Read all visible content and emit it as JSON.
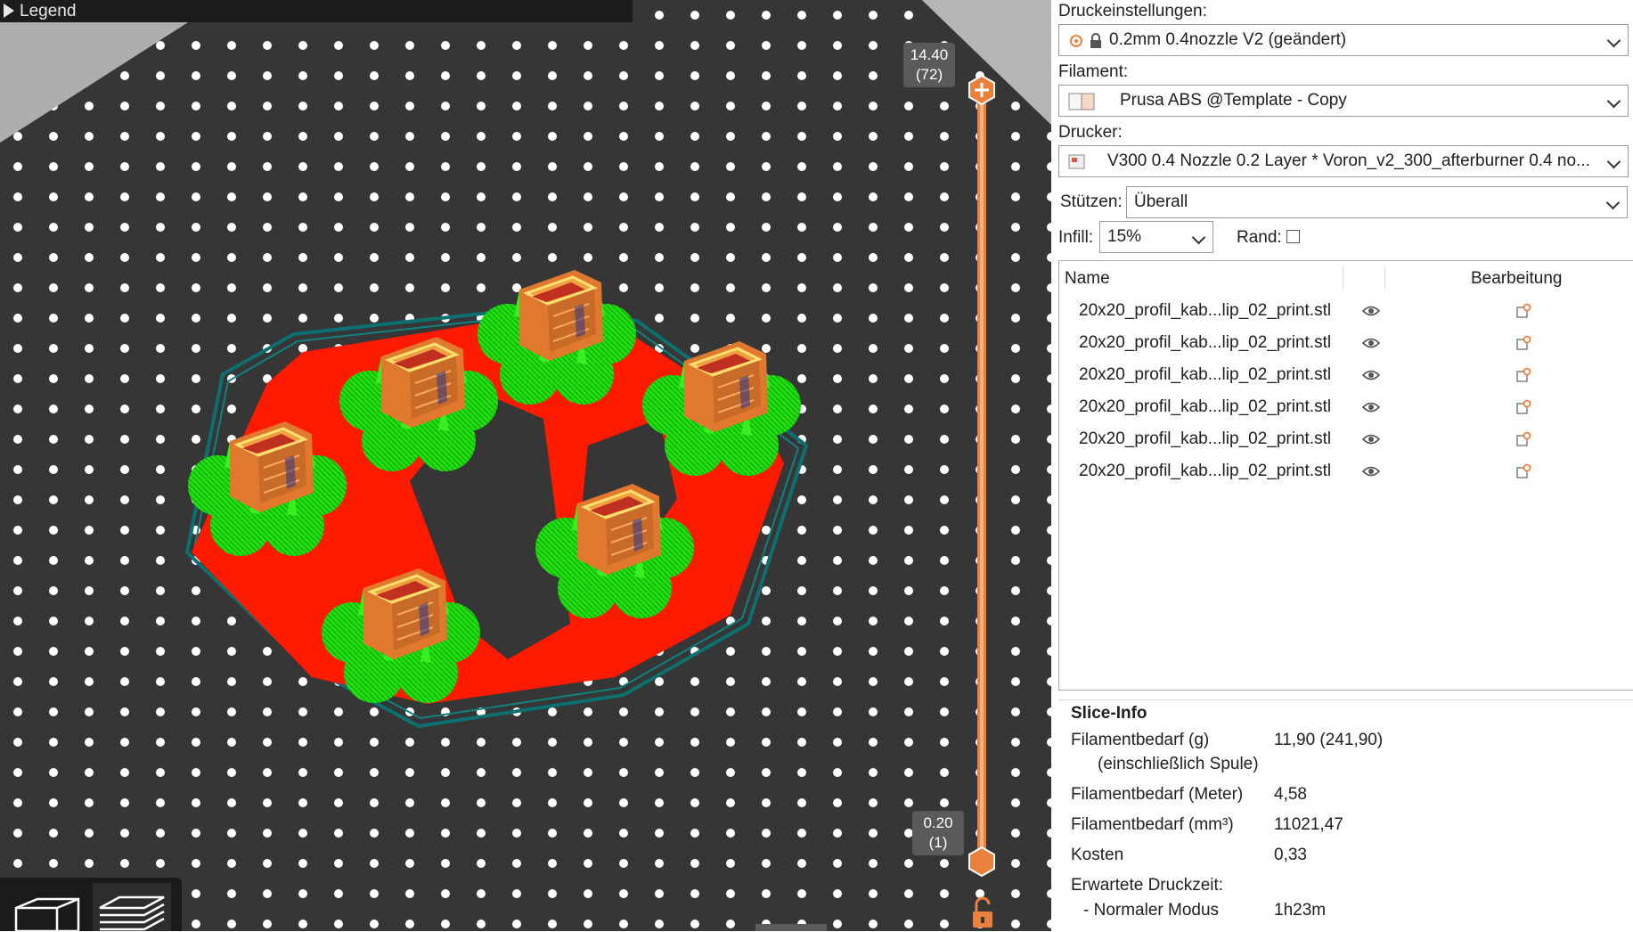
{
  "viewport": {
    "legend_label": "Legend",
    "layer_top": {
      "height": "14.40",
      "index": "(72)"
    },
    "layer_bottom": {
      "height": "0.20",
      "index": "(1)"
    },
    "icons": [
      "expand-triangle-icon",
      "add-plus-icon",
      "unlock-icon",
      "3d-view-icon",
      "preview-layers-icon"
    ],
    "colors": {
      "bed": "#363636",
      "skirt": "#0c7070",
      "support": "#ff1a00",
      "support_interface": "#22e010",
      "perimeter": "#e0782e",
      "slider": "#e9813c"
    }
  },
  "settings": {
    "print_label": "Druckeinstellungen:",
    "print_value": "0.2mm 0.4nozzle V2 (geändert)",
    "filament_label": "Filament:",
    "filament_value": "Prusa ABS @Template - Copy",
    "printer_label": "Drucker:",
    "printer_value": "V300 0.4 Nozzle 0.2 Layer * Voron_v2_300_afterburner 0.4 no...",
    "supports_label": "Stützen:",
    "supports_value": "Überall",
    "infill_label": "Infill:",
    "infill_value": "15%",
    "brim_label": "Rand:",
    "brim_checked": false
  },
  "objects": {
    "col_name": "Name",
    "col_edit": "Bearbeitung",
    "rows": [
      "20x20_profil_kab...lip_02_print.stl",
      "20x20_profil_kab...lip_02_print.stl",
      "20x20_profil_kab...lip_02_print.stl",
      "20x20_profil_kab...lip_02_print.stl",
      "20x20_profil_kab...lip_02_print.stl",
      "20x20_profil_kab...lip_02_print.stl"
    ]
  },
  "slice_info": {
    "title": "Slice-Info",
    "filament_g_label": "Filamentbedarf (g)",
    "filament_g_sub": "(einschließlich Spule)",
    "filament_g_value": "11,90 (241,90)",
    "filament_m_label": "Filamentbedarf (Meter)",
    "filament_m_value": "4,58",
    "filament_mm3_label": "Filamentbedarf (mm³)",
    "filament_mm3_value": "11021,47",
    "cost_label": "Kosten",
    "cost_value": "0,33",
    "time_label": "Erwartete Druckzeit:",
    "mode_label": "- Normaler Modus",
    "mode_value": "1h23m"
  }
}
